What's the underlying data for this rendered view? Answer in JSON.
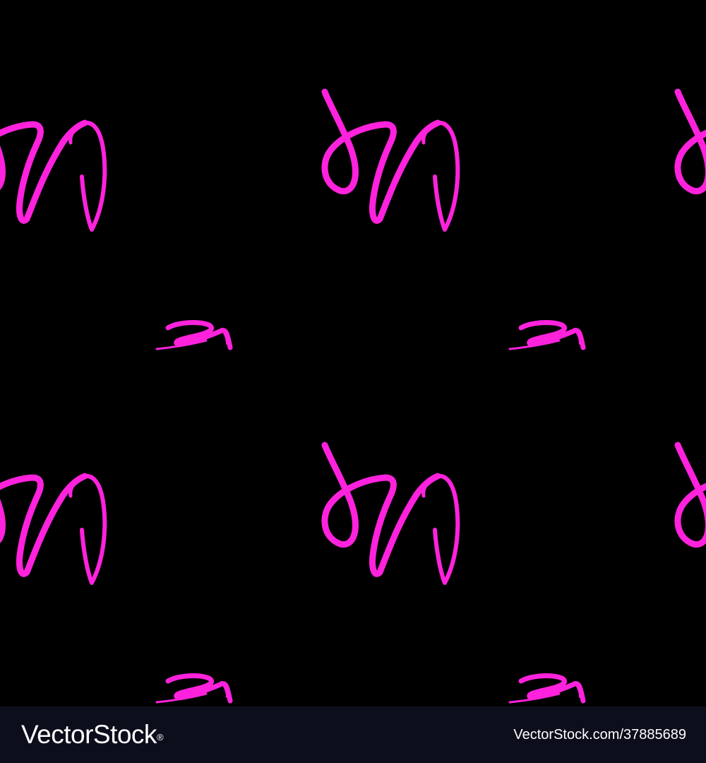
{
  "background_color": "#000000",
  "stroke_color": "#ff22dd",
  "motif": "hand-drawn pink squiggle strokes (seamless pattern)",
  "footer": {
    "background_color": "#0c0e1c",
    "logo_text": "VectorStock",
    "logo_mark": "®",
    "image_id": "VectorStock.com/37885689"
  }
}
